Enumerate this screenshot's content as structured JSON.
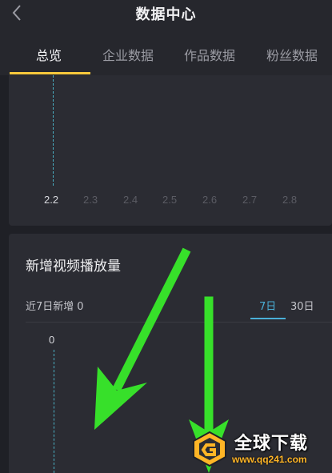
{
  "header": {
    "title": "数据中心",
    "back_icon": "chevron-left-icon"
  },
  "tabs": [
    {
      "label": "总览",
      "active": true
    },
    {
      "label": "企业数据",
      "active": false
    },
    {
      "label": "作品数据",
      "active": false
    },
    {
      "label": "粉丝数据",
      "active": false
    }
  ],
  "chart1": {
    "x_ticks": [
      "2.2",
      "2.3",
      "2.4",
      "2.5",
      "2.6",
      "2.7",
      "2.8"
    ],
    "selected_tick": "2.2"
  },
  "video_plays_card": {
    "title": "新增视频播放量",
    "subtitle_label": "近7日新增",
    "subtitle_value": "0",
    "ranges": [
      {
        "label": "7日",
        "active": true
      },
      {
        "label": "30日",
        "active": false
      }
    ],
    "y_value": "0"
  },
  "watermark": {
    "title": "全球下载",
    "url": "www.qq241.com"
  },
  "colors": {
    "background": "#1f2026",
    "card": "#2b2c33",
    "tab_underline": "#f6c83c",
    "range_accent": "#4ab0d8",
    "annotation_arrow": "#37e02a",
    "watermark_url": "#ffb526"
  }
}
